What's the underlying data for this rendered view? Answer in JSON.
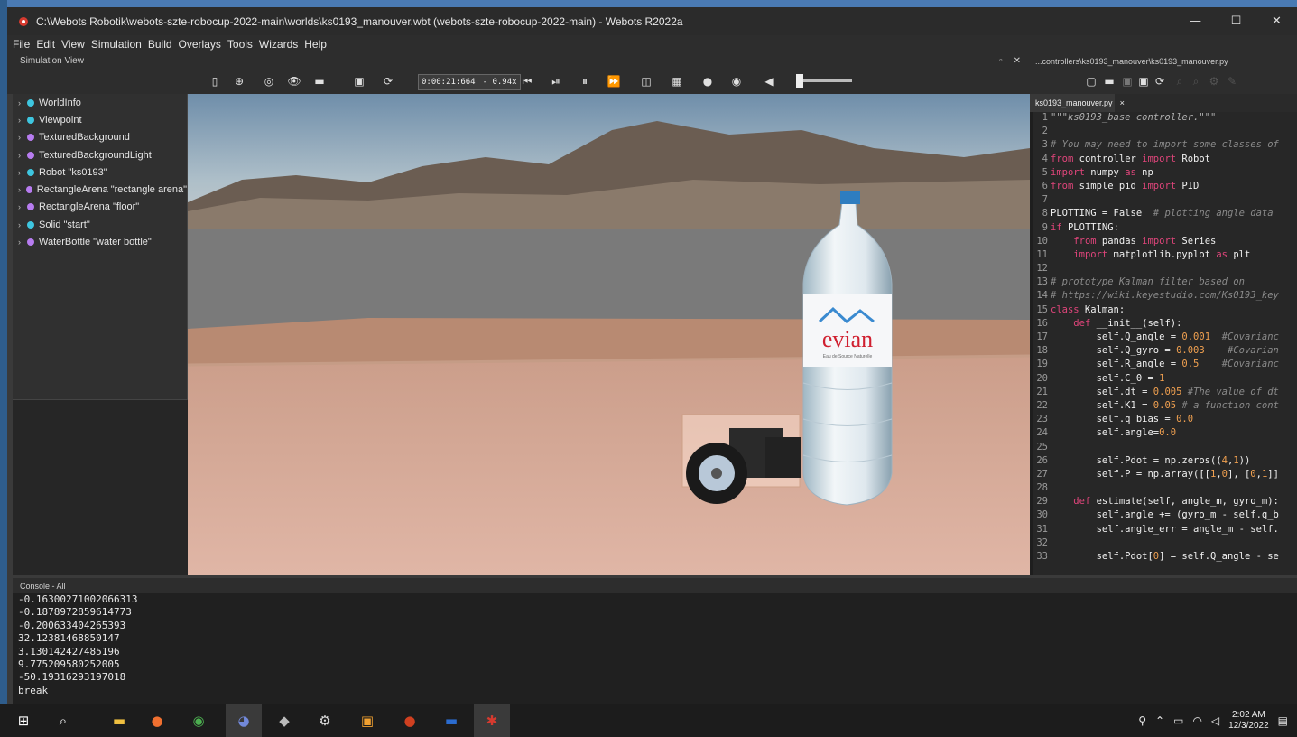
{
  "window": {
    "title": "C:\\Webots Robotik\\webots-szte-robocup-2022-main\\worlds\\ks0193_manouver.wbt (webots-szte-robocup-2022-main) - Webots R2022a",
    "minimize": "—",
    "maximize": "☐",
    "close": "✕"
  },
  "menu": [
    "File",
    "Edit",
    "View",
    "Simulation",
    "Build",
    "Overlays",
    "Tools",
    "Wizards",
    "Help"
  ],
  "simulation_view": {
    "header": "Simulation View",
    "time": "0:00:21:664",
    "speed": "- 0.94x"
  },
  "scene_tree": [
    {
      "label": "WorldInfo",
      "color": "#3ec6e0"
    },
    {
      "label": "Viewpoint",
      "color": "#3ec6e0"
    },
    {
      "label": "TexturedBackground",
      "color": "#b77cf0"
    },
    {
      "label": "TexturedBackgroundLight",
      "color": "#b77cf0"
    },
    {
      "label": "Robot \"ks0193\"",
      "color": "#3ec6e0"
    },
    {
      "label": "RectangleArena \"rectangle arena\"",
      "color": "#b77cf0"
    },
    {
      "label": "RectangleArena \"floor\"",
      "color": "#b77cf0"
    },
    {
      "label": "Solid \"start\"",
      "color": "#3ec6e0"
    },
    {
      "label": "WaterBottle \"water bottle\"",
      "color": "#b77cf0"
    }
  ],
  "bottle": {
    "brand": "evian",
    "tagline": "Eau de Source Naturelle"
  },
  "editor": {
    "header": "...controllers\\ks0193_manouver\\ks0193_manouver.py",
    "tab": "ks0193_manouver.py",
    "tab_close": "×",
    "lines": [
      {
        "n": "1",
        "t": "\"\"\"ks0193_base controller.\"\"\""
      },
      {
        "n": "2",
        "t": ""
      },
      {
        "n": "3",
        "t": "# You may need to import some classes of"
      },
      {
        "n": "4",
        "t": "from controller import Robot"
      },
      {
        "n": "5",
        "t": "import numpy as np"
      },
      {
        "n": "6",
        "t": "from simple_pid import PID"
      },
      {
        "n": "7",
        "t": ""
      },
      {
        "n": "8",
        "t": "PLOTTING = False  # plotting angle data"
      },
      {
        "n": "9",
        "t": "if PLOTTING:"
      },
      {
        "n": "10",
        "t": "    from pandas import Series"
      },
      {
        "n": "11",
        "t": "    import matplotlib.pyplot as plt"
      },
      {
        "n": "12",
        "t": ""
      },
      {
        "n": "13",
        "t": "# prototype Kalman filter based on"
      },
      {
        "n": "14",
        "t": "# https://wiki.keyestudio.com/Ks0193_key"
      },
      {
        "n": "15",
        "t": "class Kalman:"
      },
      {
        "n": "16",
        "t": "    def __init__(self):"
      },
      {
        "n": "17",
        "t": "        self.Q_angle = 0.001  #Covarianc"
      },
      {
        "n": "18",
        "t": "        self.Q_gyro = 0.003    #Covarian"
      },
      {
        "n": "19",
        "t": "        self.R_angle = 0.5    #Covarianc"
      },
      {
        "n": "20",
        "t": "        self.C_0 = 1"
      },
      {
        "n": "21",
        "t": "        self.dt = 0.005 #The value of dt"
      },
      {
        "n": "22",
        "t": "        self.K1 = 0.05 # a function cont"
      },
      {
        "n": "23",
        "t": "        self.q_bias = 0.0"
      },
      {
        "n": "24",
        "t": "        self.angle=0.0"
      },
      {
        "n": "25",
        "t": ""
      },
      {
        "n": "26",
        "t": "        self.Pdot = np.zeros((4,1))"
      },
      {
        "n": "27",
        "t": "        self.P = np.array([[1,0], [0,1]]"
      },
      {
        "n": "28",
        "t": ""
      },
      {
        "n": "29",
        "t": "    def estimate(self, angle_m, gyro_m):"
      },
      {
        "n": "30",
        "t": "        self.angle += (gyro_m - self.q_b"
      },
      {
        "n": "31",
        "t": "        self.angle_err = angle_m - self."
      },
      {
        "n": "32",
        "t": ""
      },
      {
        "n": "33",
        "t": "        self.Pdot[0] = self.Q_angle - se"
      }
    ]
  },
  "console": {
    "header": "Console - All",
    "lines": [
      "-0.16300271002066313",
      "-0.1878972859614773",
      "-0.200633404265393",
      "32.12381468850147",
      "3.130142427485196",
      "9.775209580252005",
      "-50.19316293197018",
      "break"
    ]
  },
  "taskbar": {
    "time": "2:02 AM",
    "date": "12/3/2022"
  }
}
